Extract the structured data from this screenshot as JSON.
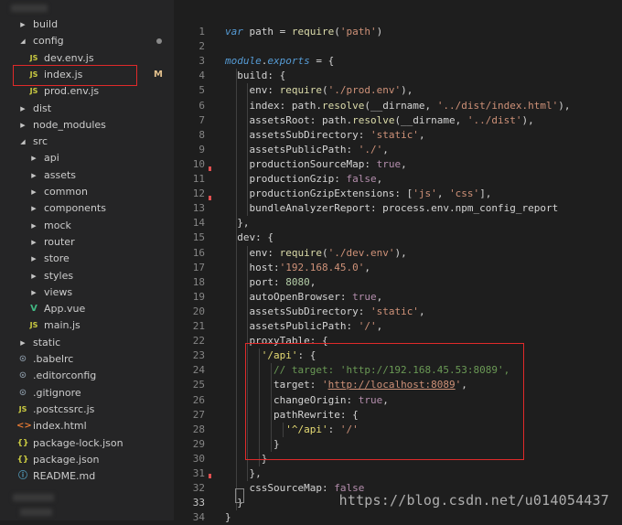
{
  "explorer": {
    "items": [
      {
        "label": "build",
        "kind": "folder",
        "open": false,
        "indent": 0
      },
      {
        "label": "config",
        "kind": "folder",
        "open": true,
        "indent": 0,
        "status": "dot"
      },
      {
        "label": "dev.env.js",
        "kind": "js",
        "indent": 1
      },
      {
        "label": "index.js",
        "kind": "js",
        "indent": 1,
        "status": "M",
        "highlight": true
      },
      {
        "label": "prod.env.js",
        "kind": "js",
        "indent": 1
      },
      {
        "label": "dist",
        "kind": "folder",
        "open": false,
        "indent": 0
      },
      {
        "label": "node_modules",
        "kind": "folder",
        "open": false,
        "indent": 0
      },
      {
        "label": "src",
        "kind": "folder",
        "open": true,
        "indent": 0
      },
      {
        "label": "api",
        "kind": "folder",
        "open": false,
        "indent": 1
      },
      {
        "label": "assets",
        "kind": "folder",
        "open": false,
        "indent": 1
      },
      {
        "label": "common",
        "kind": "folder",
        "open": false,
        "indent": 1
      },
      {
        "label": "components",
        "kind": "folder",
        "open": false,
        "indent": 1
      },
      {
        "label": "mock",
        "kind": "folder",
        "open": false,
        "indent": 1
      },
      {
        "label": "router",
        "kind": "folder",
        "open": false,
        "indent": 1
      },
      {
        "label": "store",
        "kind": "folder",
        "open": false,
        "indent": 1
      },
      {
        "label": "styles",
        "kind": "folder",
        "open": false,
        "indent": 1
      },
      {
        "label": "views",
        "kind": "folder",
        "open": false,
        "indent": 1
      },
      {
        "label": "App.vue",
        "kind": "vue",
        "indent": 1
      },
      {
        "label": "main.js",
        "kind": "js",
        "indent": 1
      },
      {
        "label": "static",
        "kind": "folder",
        "open": false,
        "indent": 0
      },
      {
        "label": ".babelrc",
        "kind": "dot",
        "indent": 0
      },
      {
        "label": ".editorconfig",
        "kind": "dot",
        "indent": 0
      },
      {
        "label": ".gitignore",
        "kind": "dot",
        "indent": 0
      },
      {
        "label": ".postcssrc.js",
        "kind": "js",
        "indent": 0
      },
      {
        "label": "index.html",
        "kind": "html",
        "indent": 0
      },
      {
        "label": "package-lock.json",
        "kind": "json",
        "indent": 0
      },
      {
        "label": "package.json",
        "kind": "json",
        "indent": 0
      },
      {
        "label": "README.md",
        "kind": "info",
        "indent": 0
      }
    ],
    "icons": {
      "js": "JS",
      "json": "{}",
      "vue": "V",
      "html": "<>",
      "dot": "⊙",
      "info": "ⓘ"
    },
    "modified_mark": "M"
  },
  "editor": {
    "active_line": 33,
    "lines": [
      [
        [
          "var",
          "var"
        ],
        [
          "p",
          " path = "
        ],
        [
          "fn",
          "require"
        ],
        [
          "p",
          "("
        ],
        [
          "str",
          "'path'"
        ],
        [
          "p",
          ")"
        ]
      ],
      [],
      [
        [
          "var",
          "module"
        ],
        [
          "p",
          "."
        ],
        [
          "var",
          "exports"
        ],
        [
          "p",
          " = {"
        ]
      ],
      [
        [
          "p",
          "  build: {"
        ]
      ],
      [
        [
          "p",
          "    env: "
        ],
        [
          "fn",
          "require"
        ],
        [
          "p",
          "("
        ],
        [
          "str",
          "'./prod.env'"
        ],
        [
          "p",
          "),"
        ]
      ],
      [
        [
          "p",
          "    index: path."
        ],
        [
          "fn",
          "resolve"
        ],
        [
          "p",
          "(__dirname, "
        ],
        [
          "str",
          "'../dist/index.html'"
        ],
        [
          "p",
          "),"
        ]
      ],
      [
        [
          "p",
          "    assetsRoot: path."
        ],
        [
          "fn",
          "resolve"
        ],
        [
          "p",
          "(__dirname, "
        ],
        [
          "str",
          "'../dist'"
        ],
        [
          "p",
          "),"
        ]
      ],
      [
        [
          "p",
          "    assetsSubDirectory: "
        ],
        [
          "str",
          "'static'"
        ],
        [
          "p",
          ","
        ]
      ],
      [
        [
          "p",
          "    assetsPublicPath: "
        ],
        [
          "str",
          "'./'"
        ],
        [
          "p",
          ","
        ]
      ],
      [
        [
          "p",
          "    productionSourceMap: "
        ],
        [
          "bool",
          "true"
        ],
        [
          "p",
          ","
        ]
      ],
      [
        [
          "p",
          "    productionGzip: "
        ],
        [
          "bool",
          "false"
        ],
        [
          "p",
          ","
        ]
      ],
      [
        [
          "p",
          "    productionGzipExtensions: ["
        ],
        [
          "str",
          "'js'"
        ],
        [
          "p",
          ", "
        ],
        [
          "str",
          "'css'"
        ],
        [
          "p",
          "],"
        ]
      ],
      [
        [
          "p",
          "    bundleAnalyzerReport: process.env.npm_config_report"
        ]
      ],
      [
        [
          "p",
          "  },"
        ]
      ],
      [
        [
          "p",
          "  dev: {"
        ]
      ],
      [
        [
          "p",
          "    env: "
        ],
        [
          "fn",
          "require"
        ],
        [
          "p",
          "("
        ],
        [
          "str",
          "'./dev.env'"
        ],
        [
          "p",
          "),"
        ]
      ],
      [
        [
          "p",
          "    host:"
        ],
        [
          "str",
          "'192.168.45.0'"
        ],
        [
          "p",
          ","
        ]
      ],
      [
        [
          "p",
          "    port: "
        ],
        [
          "num",
          "8080"
        ],
        [
          "p",
          ","
        ]
      ],
      [
        [
          "p",
          "    autoOpenBrowser: "
        ],
        [
          "bool",
          "true"
        ],
        [
          "p",
          ","
        ]
      ],
      [
        [
          "p",
          "    assetsSubDirectory: "
        ],
        [
          "str",
          "'static'"
        ],
        [
          "p",
          ","
        ]
      ],
      [
        [
          "p",
          "    assetsPublicPath: "
        ],
        [
          "str",
          "'/'"
        ],
        [
          "p",
          ","
        ]
      ],
      [
        [
          "p",
          "    proxyTable: {"
        ]
      ],
      [
        [
          "p",
          "      "
        ],
        [
          "strg",
          "'/api'"
        ],
        [
          "p",
          ": {"
        ]
      ],
      [
        [
          "p",
          "        "
        ],
        [
          "cmt",
          "// target: 'http://192.168.45.53:8089',"
        ]
      ],
      [
        [
          "p",
          "        target: "
        ],
        [
          "str",
          "'"
        ],
        [
          "url",
          "http://localhost:8089"
        ],
        [
          "str",
          "'"
        ],
        [
          "p",
          ","
        ]
      ],
      [
        [
          "p",
          "        changeOrigin: "
        ],
        [
          "bool",
          "true"
        ],
        [
          "p",
          ","
        ]
      ],
      [
        [
          "p",
          "        pathRewrite: {"
        ]
      ],
      [
        [
          "p",
          "          "
        ],
        [
          "strg",
          "'^/api'"
        ],
        [
          "p",
          ": "
        ],
        [
          "str",
          "'/'"
        ]
      ],
      [
        [
          "p",
          "        }"
        ]
      ],
      [
        [
          "p",
          "      }"
        ]
      ],
      [
        [
          "p",
          "    },"
        ]
      ],
      [
        [
          "p",
          "    cssSourceMap: "
        ],
        [
          "bool",
          "false"
        ]
      ],
      [
        [
          "p",
          "  }"
        ]
      ],
      [
        [
          "p",
          "}"
        ]
      ]
    ]
  },
  "watermark": "https://blog.csdn.net/u014054437",
  "colors": {
    "accent_red": "#e02a2a",
    "background": "#1e1e1e",
    "sidebar": "#252526"
  }
}
